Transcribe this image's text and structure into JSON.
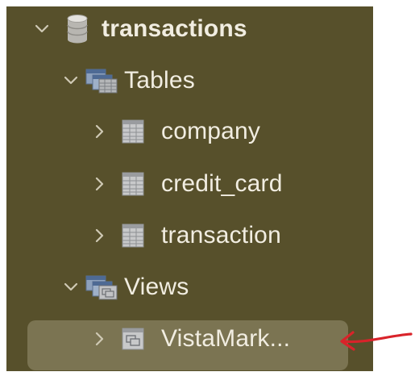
{
  "tree": {
    "database": {
      "label": "transactions",
      "icon": "database-icon",
      "expanded": true
    },
    "tables_folder": {
      "label": "Tables",
      "icon": "tables-folder-icon",
      "expanded": true,
      "items": [
        {
          "label": "company",
          "icon": "table-icon",
          "expanded": false
        },
        {
          "label": "credit_card",
          "icon": "table-icon",
          "expanded": false
        },
        {
          "label": "transaction",
          "icon": "table-icon",
          "expanded": false
        }
      ]
    },
    "views_folder": {
      "label": "Views",
      "icon": "views-folder-icon",
      "expanded": true,
      "items": [
        {
          "label": "VistaMark...",
          "icon": "view-icon",
          "expanded": false,
          "selected": true
        }
      ]
    }
  },
  "colors": {
    "panel_background": "#57502b",
    "selected_background": "#7b7452",
    "text": "#f1ede1",
    "annotation_arrow": "#d9232a"
  }
}
